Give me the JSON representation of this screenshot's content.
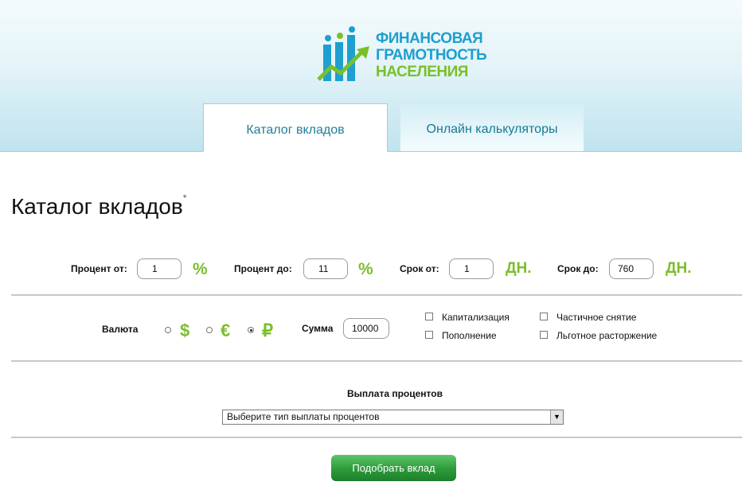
{
  "logo": {
    "line1": "ФИНАНСОВАЯ",
    "line2": "ГРАМОТНОСТЬ",
    "line3": "НАСЕЛЕНИЯ"
  },
  "tabs": [
    {
      "label": "Каталог вкладов",
      "active": true
    },
    {
      "label": "Онлайн калькуляторы",
      "active": false
    }
  ],
  "page": {
    "title": "Каталог вкладов",
    "footnote_mark": "*"
  },
  "filters": {
    "percent_from": {
      "label": "Процент от:",
      "value": "1",
      "unit": "%"
    },
    "percent_to": {
      "label": "Процент до:",
      "value": "11",
      "unit": "%"
    },
    "term_from": {
      "label": "Срок от:",
      "value": "1",
      "unit": "ДН."
    },
    "term_to": {
      "label": "Срок до:",
      "value": "760",
      "unit": "ДН."
    }
  },
  "currency": {
    "label": "Валюта",
    "options": [
      {
        "symbol": "$",
        "checked": false
      },
      {
        "symbol": "€",
        "checked": false
      },
      {
        "symbol": "₽",
        "checked": true
      }
    ]
  },
  "amount": {
    "label": "Сумма",
    "value": "10000"
  },
  "checkboxes": [
    {
      "label": "Капитализация",
      "checked": false
    },
    {
      "label": "Пополнение",
      "checked": false
    },
    {
      "label": "Частичное снятие",
      "checked": false
    },
    {
      "label": "Льготное расторжение",
      "checked": false
    }
  ],
  "payout": {
    "label": "Выплата процентов",
    "selected": "Выберите тип выплаты процентов"
  },
  "submit_label": "Подобрать вклад",
  "colors": {
    "accent_green": "#7bbf2a",
    "brand_blue": "#1d9fd0",
    "button_green": "#2d9a3a"
  }
}
